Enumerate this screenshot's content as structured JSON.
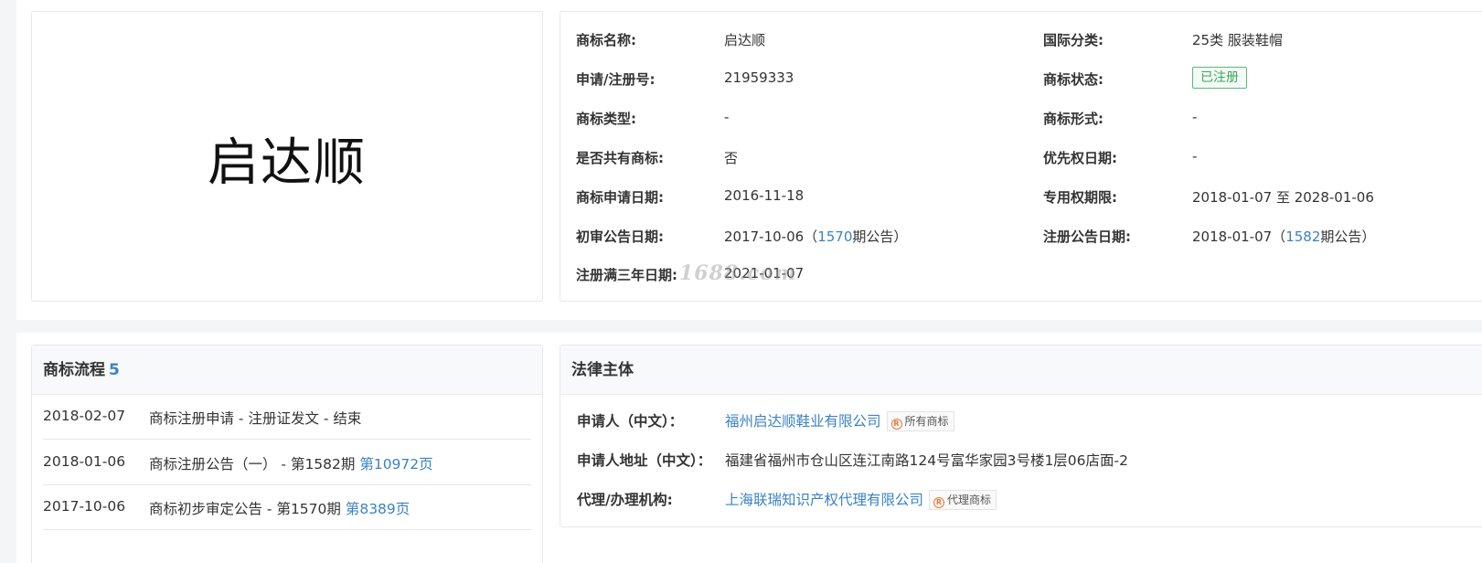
{
  "trademark": {
    "logo_text": "启达顺",
    "fields": [
      {
        "label": "商标名称:",
        "value": "启达顺"
      },
      {
        "label": "国际分类:",
        "value": "25类 服装鞋帽"
      },
      {
        "label": "申请/注册号:",
        "value": "21959333"
      },
      {
        "label": "商标状态:",
        "value": "已注册"
      },
      {
        "label": "商标类型:",
        "value": "-"
      },
      {
        "label": "商标形式:",
        "value": "-"
      },
      {
        "label": "是否共有商标:",
        "value": "否"
      },
      {
        "label": "优先权日期:",
        "value": "-"
      },
      {
        "label": "商标申请日期:",
        "value": "2016-11-18"
      },
      {
        "label": "专用权期限:",
        "value": "2018-01-07 至 2028-01-06"
      },
      {
        "label": "初审公告日期:",
        "value_prefix": "2017-10-06（",
        "value_link": "1570",
        "value_suffix": "期公告）"
      },
      {
        "label": "注册公告日期:",
        "value_prefix": "2018-01-07（",
        "value_link": "1582",
        "value_suffix": "期公告）"
      },
      {
        "label": "注册满三年日期:",
        "value": "2021-01-07"
      }
    ],
    "watermark": "1688.com"
  },
  "flow": {
    "title": "商标流程",
    "count": "5",
    "items": [
      {
        "date": "2018-02-07",
        "desc": "商标注册申请 - 注册证发文 - 结束",
        "link": ""
      },
      {
        "date": "2018-01-06",
        "desc": "商标注册公告（一） - 第1582期 ",
        "link": "第10972页"
      },
      {
        "date": "2017-10-06",
        "desc": "商标初步审定公告 - 第1570期 ",
        "link": "第8389页"
      }
    ]
  },
  "legal": {
    "title": "法律主体",
    "applicant_label": "申请人（中文）：",
    "applicant_value": "福州启达顺鞋业有限公司",
    "applicant_badge": "所有商标",
    "address_label": "申请人地址（中文）：",
    "address_value": "福建省福州市仓山区连江南路124号富华家园3号楼1层06店面-2",
    "agent_label": "代理/办理机构:",
    "agent_value": "上海联瑞知识产权代理有限公司",
    "agent_badge": "代理商标"
  },
  "colors": {
    "link": "#3a82c5",
    "status_green": "#3ba55c",
    "badge_icon": "#e8793a"
  }
}
